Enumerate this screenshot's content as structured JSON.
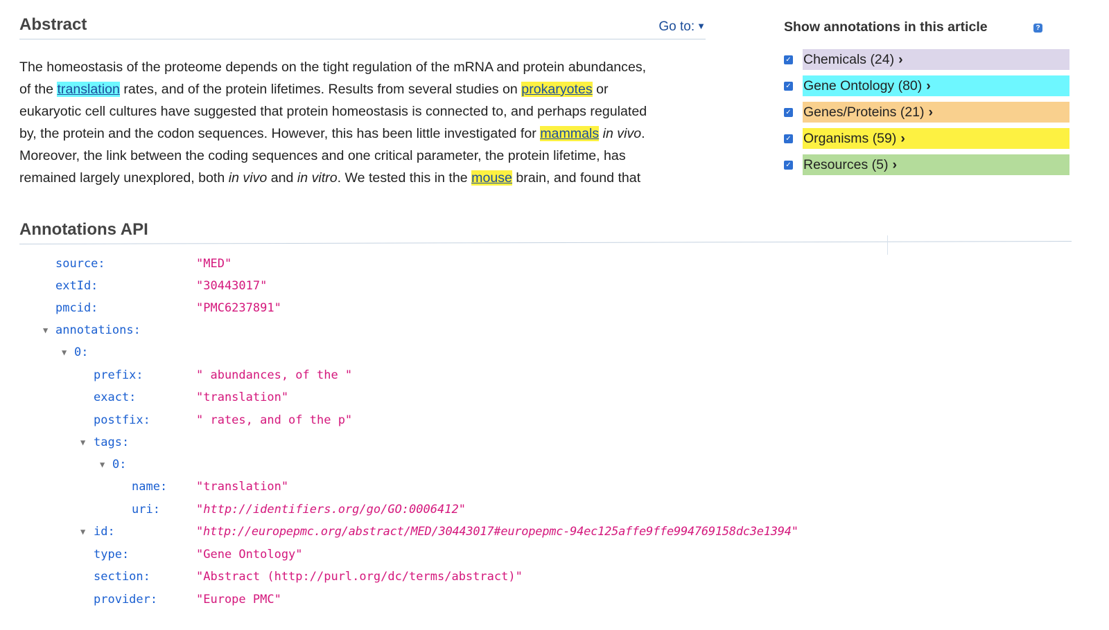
{
  "abstract": {
    "title": "Abstract",
    "goto_label": "Go to:",
    "text": {
      "l1": "The homeostasis of the proteome depends on the tight regulation of the mRNA and protein abundances,",
      "l2a": "of the",
      "term_translation": "translation",
      "l2b": "rates, and of the protein lifetimes. Results from several studies on",
      "term_prokaryotes": "prokaryotes",
      "l2c": "or",
      "l3": "eukaryotic cell cultures have suggested that protein homeostasis is connected to, and perhaps regulated",
      "l4a": "by, the protein and the codon sequences. However, this has been little investigated for",
      "term_mammals": "mammals",
      "in_vivo_1": "in vivo",
      "l4b": ".",
      "l5": "Moreover, the link between the coding sequences and one critical parameter, the protein lifetime, has",
      "l6a": "remained largely unexplored, both",
      "in_vivo_2": "in vivo",
      "l6b": "and",
      "in_vitro": "in vitro",
      "l6c": ". We tested this in the",
      "term_mouse": "mouse",
      "l6d": "brain, and found that"
    }
  },
  "annotations_panel": {
    "title": "Show annotations in this article",
    "help_icon": "?",
    "items": [
      {
        "label": "Chemicals (24)",
        "color": "#dcd6ea",
        "checked": true
      },
      {
        "label": "Gene Ontology (80)",
        "color": "#6ef7ff",
        "checked": true
      },
      {
        "label": "Genes/Proteins (21)",
        "color": "#f9d08e",
        "checked": true
      },
      {
        "label": "Organisms (59)",
        "color": "#fdf142",
        "checked": true
      },
      {
        "label": "Resources (5)",
        "color": "#b4dc9b",
        "checked": true
      }
    ]
  },
  "api": {
    "title": "Annotations API",
    "rows": [
      {
        "key": "source:",
        "value": "\"MED\""
      },
      {
        "key": "extId:",
        "value": "\"30443017\""
      },
      {
        "key": "pmcid:",
        "value": "\"PMC6237891\""
      },
      {
        "key": "annotations:",
        "value": "",
        "toggle": "▼"
      },
      {
        "key": "0:",
        "value": "",
        "toggle": "▼"
      },
      {
        "key": "prefix:",
        "value": "\" abundances, of the \""
      },
      {
        "key": "exact:",
        "value": "\"translation\""
      },
      {
        "key": "postfix:",
        "value": "\" rates, and of the p\""
      },
      {
        "key": "tags:",
        "value": "",
        "toggle": "▼"
      },
      {
        "key": "0:",
        "value": "",
        "toggle": "▼"
      },
      {
        "key": "name:",
        "value": "\"translation\""
      },
      {
        "key": "uri:",
        "value": "\"http://identifiers.org/go/GO:0006412\"",
        "italic": true
      },
      {
        "key": "id:",
        "value": "\"http://europepmc.org/abstract/MED/30443017#europepmc-94ec125affe9ffe994769158dc3e1394\"",
        "italic": true,
        "toggle": "▼"
      },
      {
        "key": "type:",
        "value": "\"Gene Ontology\""
      },
      {
        "key": "section:",
        "value": "\"Abstract (http://purl.org/dc/terms/abstract)\""
      },
      {
        "key": "provider:",
        "value": "\"Europe PMC\""
      }
    ]
  },
  "colors": {
    "link": "#1d4e9a",
    "json_key": "#1a5fd1",
    "json_value": "#d4177c",
    "checkbox": "#2d6fd2"
  }
}
